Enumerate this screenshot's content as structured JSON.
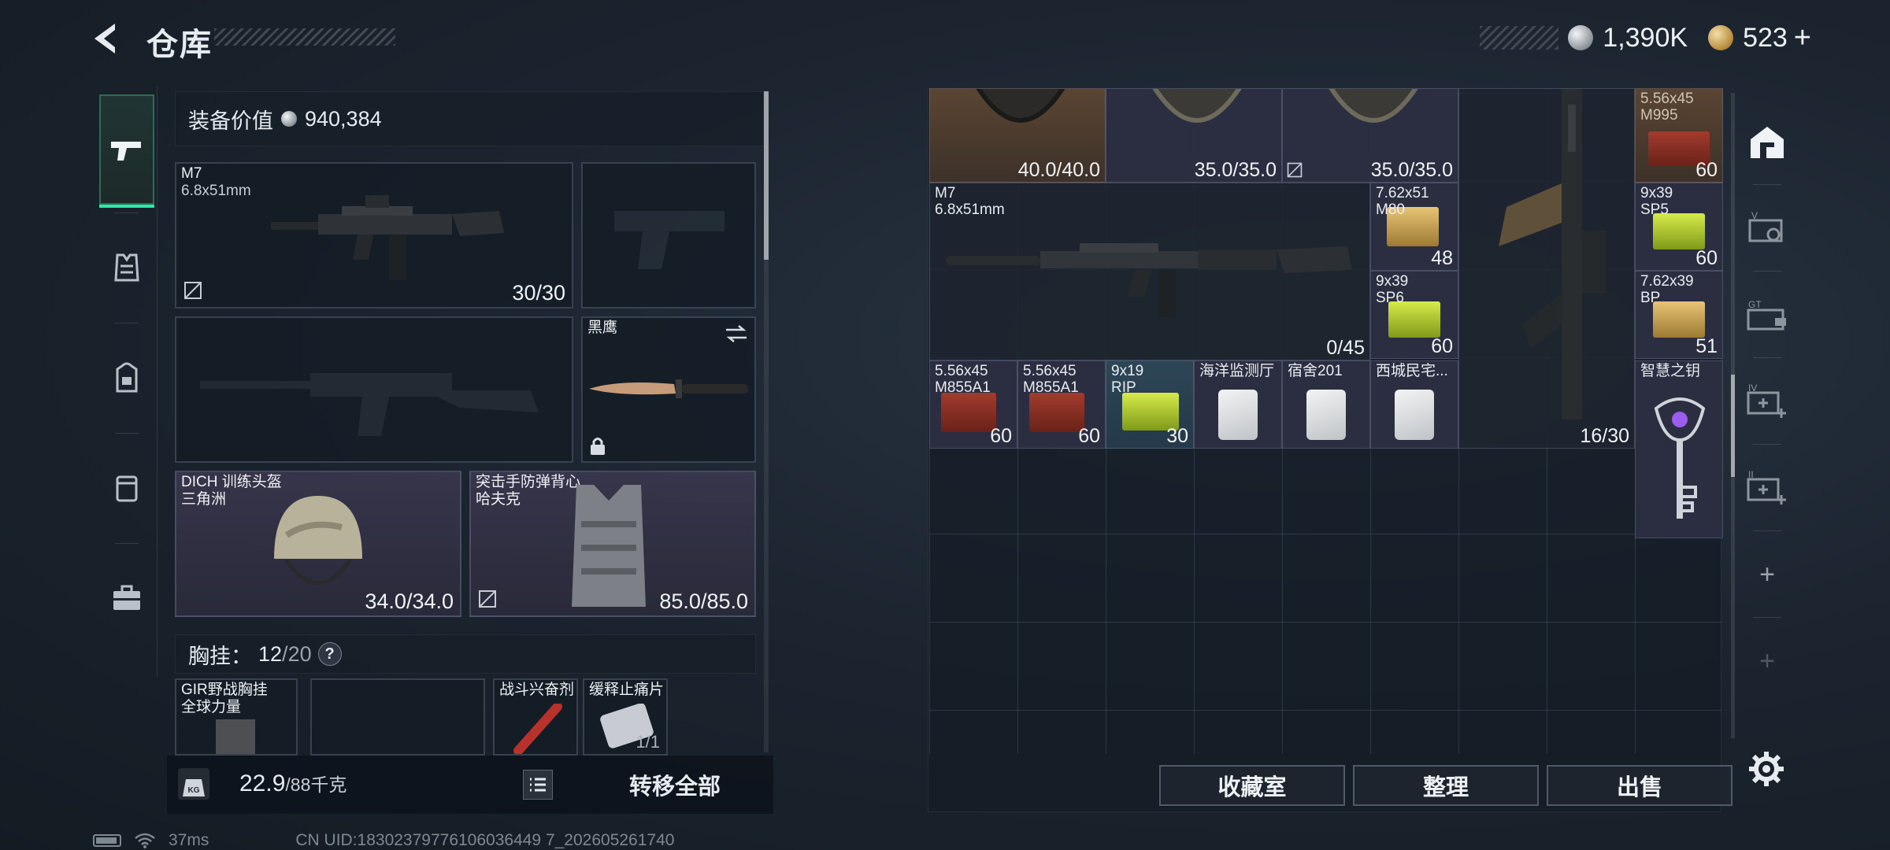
{
  "header": {
    "title": "仓库"
  },
  "currency": [
    {
      "icon": "silver-coin-icon",
      "value": "1,390K"
    },
    {
      "icon": "gold-coin-icon",
      "value": "523"
    }
  ],
  "plus_label": "+",
  "left_nav": [
    {
      "icon": "pistol-icon",
      "active": true
    },
    {
      "icon": "vest-icon"
    },
    {
      "icon": "backpack-icon"
    },
    {
      "icon": "pouch-icon"
    },
    {
      "icon": "toolbox-icon"
    }
  ],
  "equip_value": {
    "label": "装备价值",
    "value": "940,384"
  },
  "slots": {
    "primary": {
      "name": "M7",
      "sub": "6.8x51mm",
      "count": "30/30"
    },
    "melee": {
      "name": "黑鹰"
    },
    "helmet": {
      "name": "DICH 训练头盔",
      "sub": "三角洲",
      "count": "34.0/34.0"
    },
    "armor": {
      "name": "突击手防弹背心",
      "sub": "哈夫克",
      "count": "85.0/85.0"
    }
  },
  "chest_rig": {
    "label": "胸挂：",
    "used": "12",
    "sep": "/",
    "capacity": "20",
    "help": "?",
    "items": [
      {
        "name": "GIR野战胸挂",
        "sub": "全球力量"
      },
      {
        "name": ""
      },
      {
        "name": "战斗兴奋剂"
      },
      {
        "name": "缓释止痛片",
        "count": "1/1"
      }
    ]
  },
  "bottom_left": {
    "weight": "22.9",
    "weight_unit": "/88千克",
    "kg_label": "KG",
    "transfer_all": "转移全部"
  },
  "status": {
    "ping": "37ms",
    "uid": "CN UID:18302379776106036449 7_202605261740"
  },
  "stash_items": {
    "row0": [
      {
        "count": "40.0/40.0"
      },
      {
        "count": "35.0/35.0"
      },
      {
        "count": "35.0/35.0"
      }
    ],
    "rifle": {
      "name": "M7",
      "sub": "6.8x51mm",
      "count": "0/45"
    },
    "ammo_a": {
      "name": "7.62x51",
      "sub": "M80",
      "count": "48"
    },
    "ammo_b": {
      "name": "9x39",
      "sub": "SP6",
      "count": "60"
    },
    "smg": {
      "count": "16/30"
    },
    "ammo_top_right": {
      "name": "5.56x45",
      "sub": "M995",
      "count": "60"
    },
    "ammo_sp5": {
      "name": "9x39",
      "sub": "SP5",
      "count": "60"
    },
    "ammo_bp": {
      "name": "7.62x39",
      "sub": "BP",
      "count": "51"
    },
    "row3": [
      {
        "name": "5.56x45",
        "sub": "M855A1",
        "count": "60"
      },
      {
        "name": "5.56x45",
        "sub": "M855A1",
        "count": "60"
      },
      {
        "name": "9x19",
        "sub": "RIP",
        "count": "30"
      },
      {
        "name": "海洋监测厅"
      },
      {
        "name": "宿舍201"
      },
      {
        "name": "西城民宅..."
      }
    ],
    "key": {
      "name": "智慧之钥"
    }
  },
  "right_column": [
    {
      "icon": "home-base-icon"
    },
    {
      "icon": "safe-box-v-icon",
      "label": "V"
    },
    {
      "icon": "storage-gt-icon",
      "label": "GT"
    },
    {
      "icon": "expand-iv-icon",
      "label": "IV"
    },
    {
      "icon": "expand-ii-icon",
      "label": "II"
    },
    {
      "icon": "add-icon",
      "label": "+"
    },
    {
      "icon": "add-icon",
      "label": "+"
    }
  ],
  "bottom_buttons": {
    "collection": "收藏室",
    "organize": "整理",
    "sell": "出售"
  },
  "colors": {
    "accent": "#2ee6a6",
    "panel": "#161e28",
    "purple_slot": "#3a374e",
    "brown_item": "#5a4533"
  }
}
